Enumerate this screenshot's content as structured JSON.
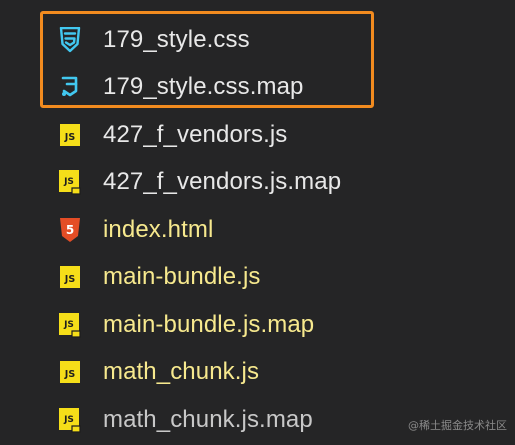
{
  "explorer": {
    "files": [
      {
        "name": "179_style.css",
        "icon": "css-file-icon",
        "kind": "css"
      },
      {
        "name": "179_style.css.map",
        "icon": "css-map-file-icon",
        "kind": "css"
      },
      {
        "name": "427_f_vendors.js",
        "icon": "js-file-icon",
        "kind": "js"
      },
      {
        "name": "427_f_vendors.js.map",
        "icon": "js-map-file-icon",
        "kind": "js"
      },
      {
        "name": "index.html",
        "icon": "html-file-icon",
        "kind": "html"
      },
      {
        "name": "main-bundle.js",
        "icon": "js-file-icon",
        "kind": "js"
      },
      {
        "name": "main-bundle.js.map",
        "icon": "js-map-file-icon",
        "kind": "js"
      },
      {
        "name": "math_chunk.js",
        "icon": "js-file-icon",
        "kind": "js"
      },
      {
        "name": "math_chunk.js.map",
        "icon": "js-map-file-icon",
        "kind": "js"
      }
    ],
    "highlight_color": "#f28b1f",
    "css_icon_color": "#42c8f0",
    "js_icon_color": "#f5de19",
    "html_icon_color": "#e44d26"
  },
  "watermark": "@稀土掘金技术社区"
}
